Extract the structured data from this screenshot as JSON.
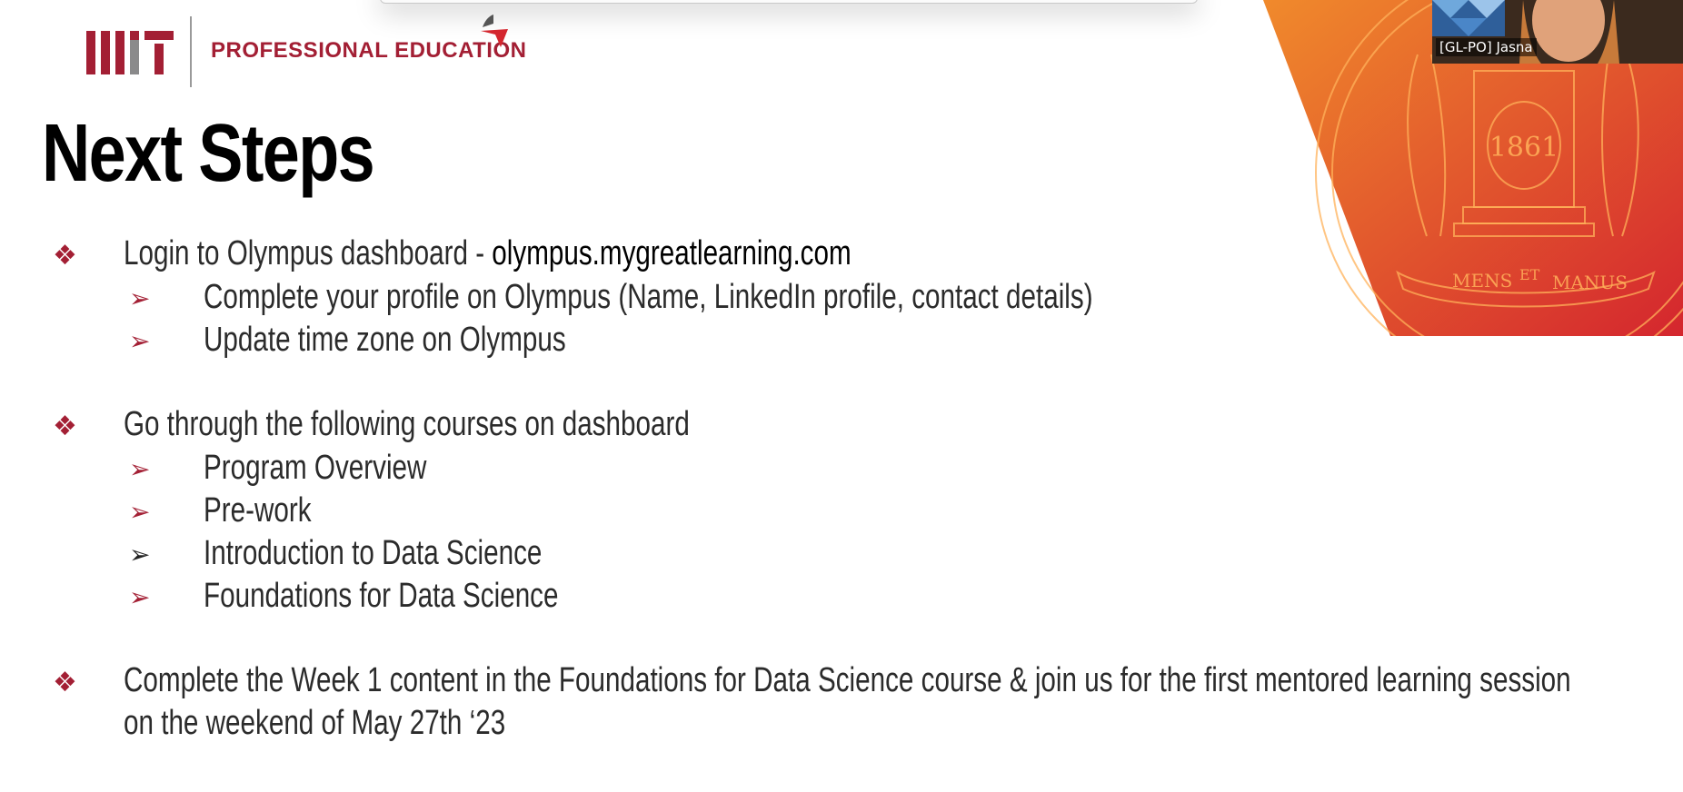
{
  "logo": {
    "org_text": "PROFESSIONAL EDUCATION"
  },
  "slide": {
    "title": "Next Steps",
    "bullets": [
      {
        "text": "Login to Olympus dashboard - ",
        "link": "olympus.mygreatlearning.com",
        "subitems": [
          "Complete your profile on Olympus (Name, LinkedIn profile, contact details)",
          "Update time zone on Olympus"
        ]
      },
      {
        "text": "Go through the following courses on dashboard",
        "subitems": [
          "Program Overview",
          "Pre-work",
          "Introduction to Data Science",
          "Foundations for Data Science"
        ]
      },
      {
        "line1": "Complete the Week 1 content in the Foundations for Data Science course & join us for the first mentored learning session",
        "line2": "on the weekend of May 27th ‘23"
      }
    ]
  },
  "seal": {
    "year": "1861",
    "motto": [
      "MENS",
      "ET",
      "MANUS"
    ]
  },
  "video": {
    "participant_name": "[GL-PO] Jasna"
  },
  "colors": {
    "accent": "#a31f34",
    "banner_start": "#f08a2c",
    "banner_end": "#d4262e"
  },
  "icons": {
    "level1_bullet": "diamond-cluster-icon",
    "level2_bullet": "arrowhead-icon"
  }
}
